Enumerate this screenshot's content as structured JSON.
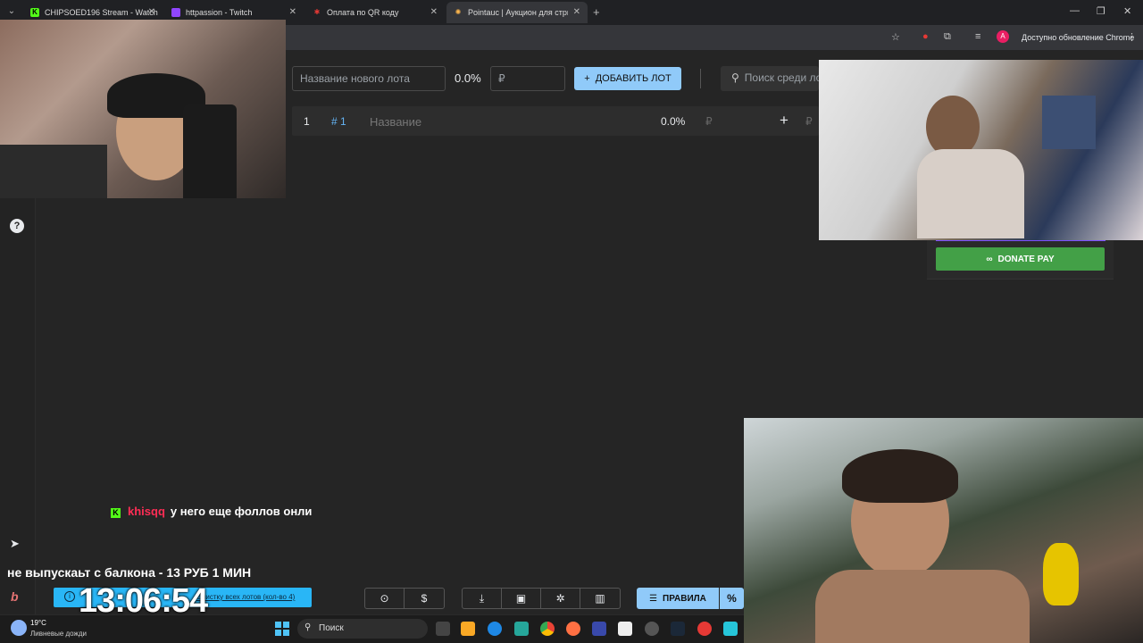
{
  "tabs": [
    {
      "title": "CHIPSOED196 Stream - Watch",
      "fav": "K",
      "fav_color": "#53fc18"
    },
    {
      "title": "httpassion - Twitch",
      "fav": "",
      "fav_color": "#9146ff"
    },
    {
      "title": "Оплата по QR коду",
      "fav": "✱",
      "fav_color": "#e53935"
    },
    {
      "title": "Pointauc | Аукцион для стримера",
      "fav": "✺",
      "fav_color": "#ffb74d"
    }
  ],
  "tab_close": "✕",
  "new_tab": "+",
  "window_controls": {
    "minimize": "—",
    "maximize": "❐",
    "close": "✕"
  },
  "toolbar": {
    "update_label": "Доступно обновление Chrome",
    "profile_initial": "A",
    "icons": [
      "star-icon",
      "extension-icon",
      "puzzle-icon",
      "media-icon",
      "profile-icon",
      "menu-icon"
    ]
  },
  "lot_form": {
    "name_placeholder": "Название нового лота",
    "percent": "0.0%",
    "price_placeholder": "₽",
    "add_button": "ДОБАВИТЬ ЛОТ",
    "search_placeholder": "Поиск среди лотов"
  },
  "lot_rows": [
    {
      "rank": "1",
      "id": "# 1",
      "name_placeholder": "Название",
      "percent": "0.0%",
      "currency": "₽",
      "add": "+",
      "currency2": "₽"
    }
  ],
  "donate": {
    "button": "DONATE PAY",
    "accent": "#7c4dff"
  },
  "chat": {
    "badge": "K",
    "user": "khisqq",
    "message": "у него еще фоллов онли"
  },
  "donation_alert": "не выпускаьт с балкона - 13 РУБ 1 МИН",
  "info_bar": {
    "text": "Очистку всех лотов (кол-во 4)"
  },
  "timer": "13:06:54",
  "bottom_buttons": {
    "group1": [
      "github-icon",
      "dollar-icon"
    ],
    "dollar": "$",
    "group2": [
      "download-icon",
      "save-icon",
      "bug-icon",
      "clear-icon"
    ],
    "rules": "ПРАВИЛА",
    "percent": "%"
  },
  "taskbar": {
    "temp": "19°C",
    "weather": "Ливневые дожди",
    "search": "Поиск"
  },
  "sidebar": {
    "help": "?",
    "telegram": "➤",
    "b_icon": "b"
  }
}
